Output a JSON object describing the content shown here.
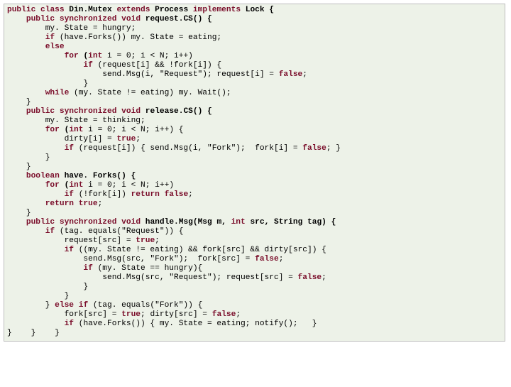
{
  "kw": {
    "public": "public",
    "class": "class",
    "extends": "extends",
    "implements": "implements",
    "synchronized": "synchronized",
    "void": "void",
    "if": "if",
    "else": "else",
    "else_if": "else if",
    "for": "for",
    "int": "int",
    "while": "while",
    "boolean": "boolean",
    "false": "false",
    "true": "true",
    "return_false": "return false",
    "return_true": "return true"
  },
  "t": {
    "cls_decl_1": " Din.Mutex ",
    "cls_decl_2": " Process ",
    "cls_decl_3": " Lock {",
    "m_req_sig": " request.CS() {",
    "req_l1": "my. State = hungry;",
    "req_if_cond": " (have.Forks()) my. State = eating;",
    "req_for": " i = 0; i < N; i++)",
    "req_if2": " (request[i] && !fork[i]) {",
    "req_send": "send.Msg(i, \"Request\"); request[i] = ",
    "semi": ";",
    "rbrace": "}",
    "req_while": " (my. State != eating) my. Wait();",
    "m_rel_sig": " release.CS() {",
    "rel_l1": "my. State = thinking;",
    "rel_for": " i = 0; i < N; i++) {",
    "rel_dirty": "dirty[i] = ",
    "rel_if": " (request[i]) { send.Msg(i, \"Fork\");  fork[i] = ",
    "rel_if_tail": "; }",
    "have_sig": " have. Forks() {",
    "have_for": " i = 0; i < N; i++)",
    "have_if": " (!fork[i]) ",
    "m_hdl_sig": " handle.Msg(Msg m, ",
    "m_hdl_sig2": " src, String tag) {",
    "hdl_if1": " (tag. equals(\"Request\")) {",
    "hdl_req_src": "request[src] = ",
    "hdl_if2": " ((my. State != eating) && fork[src] && dirty[src]) {",
    "hdl_send_fork": "send.Msg(src, \"Fork\");  fork[src] = ",
    "hdl_if3": " (my. State == hungry){",
    "hdl_send_req": "send.Msg(src, \"Request\"); request[src] = ",
    "hdl_elif": " (tag. equals(\"Fork\")) {",
    "hdl_fork_src": "fork[src] = ",
    "hdl_dirty_src": "; dirty[src] = ",
    "hdl_last_if": " (have.Forks()) { my. State = eating; notify();   }",
    "sp1": " ",
    "sp4": "    ",
    "sp8": "        ",
    "sp12": "            ",
    "sp16": "                ",
    "sp20": "                    "
  }
}
